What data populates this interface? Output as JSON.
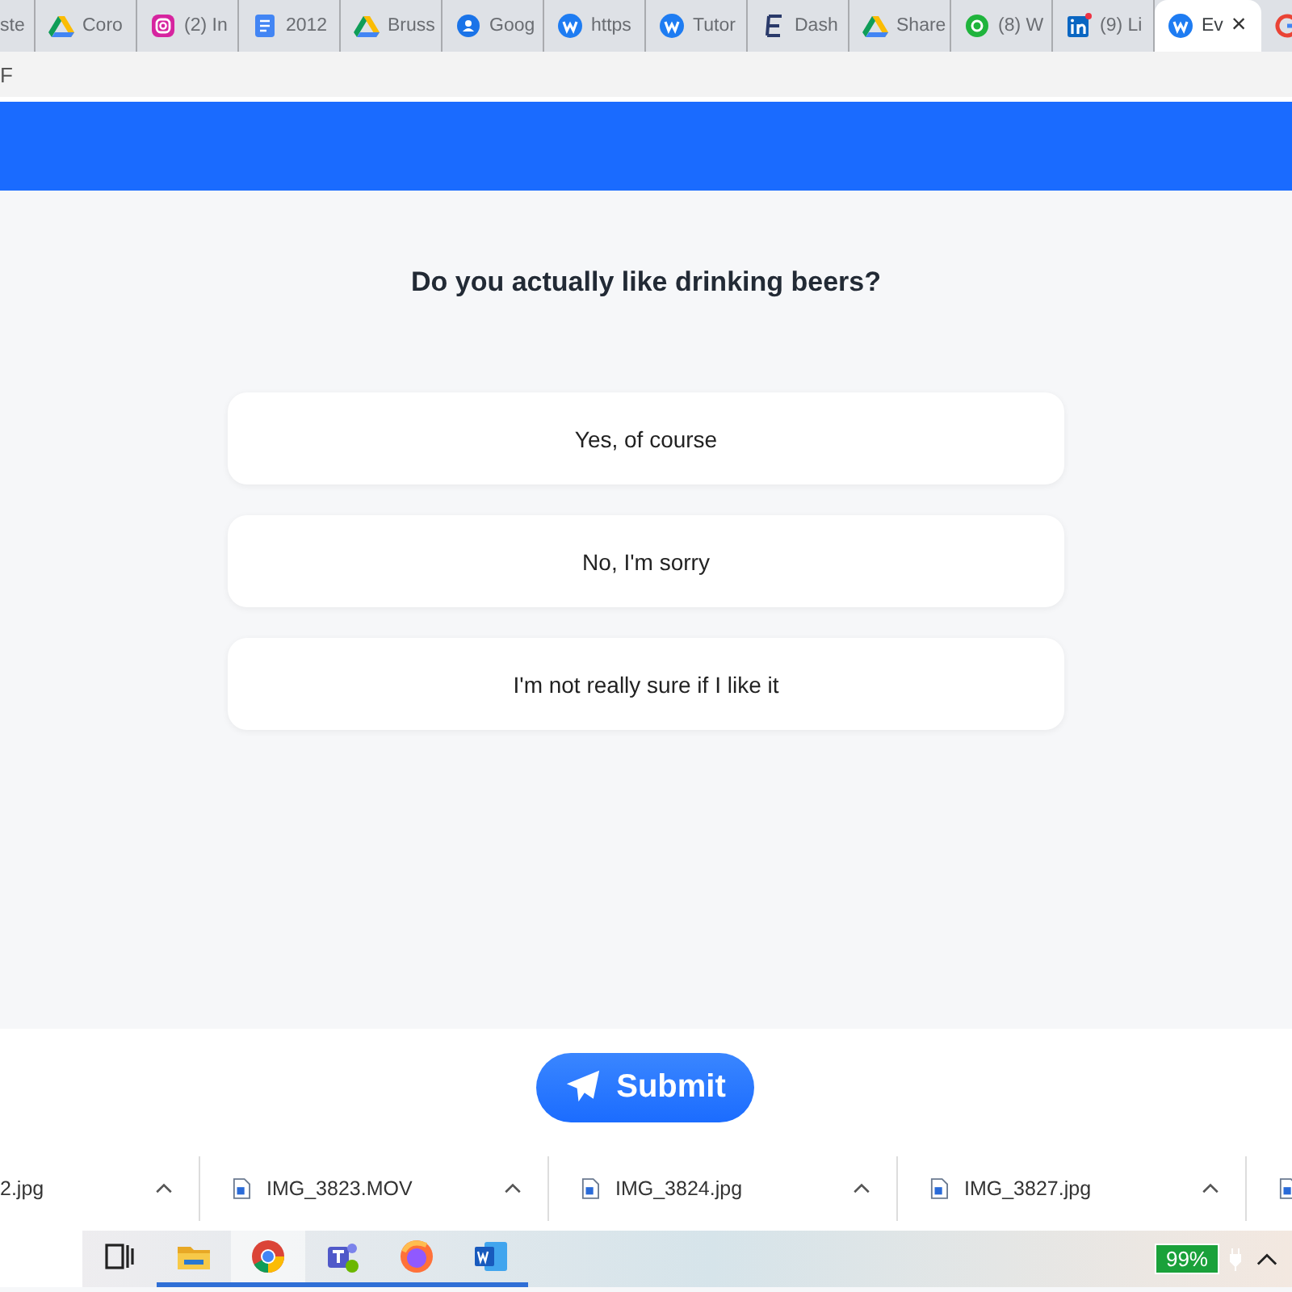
{
  "tabs": [
    {
      "label": "ste",
      "kind": "none",
      "selected": false
    },
    {
      "label": "Coro",
      "kind": "drive",
      "selected": false
    },
    {
      "label": "(2) In",
      "kind": "instagram",
      "selected": false
    },
    {
      "label": "2012",
      "kind": "docs",
      "selected": false
    },
    {
      "label": "Bruss",
      "kind": "drive",
      "selected": false
    },
    {
      "label": "Goog",
      "kind": "account",
      "selected": false
    },
    {
      "label": "https",
      "kind": "w",
      "selected": false
    },
    {
      "label": "Tutor",
      "kind": "w",
      "selected": false
    },
    {
      "label": "Dash",
      "kind": "e",
      "selected": false
    },
    {
      "label": "Share",
      "kind": "drive",
      "selected": false
    },
    {
      "label": "(8) W",
      "kind": "chat",
      "selected": false
    },
    {
      "label": "(9) Li",
      "kind": "linkedin",
      "selected": false
    },
    {
      "label": "Ev",
      "kind": "w",
      "selected": true,
      "close": "×"
    },
    {
      "kind": "google",
      "selected": false
    }
  ],
  "address_bar": {
    "value": "F"
  },
  "question": "Do you actually like drinking beers?",
  "options": [
    {
      "label": "Yes, of course",
      "selected": false
    },
    {
      "label": "No, I'm sorry",
      "selected": false
    },
    {
      "label": "I'm not really sure if I like it",
      "selected": false
    }
  ],
  "submit_button": "Submit",
  "downloads": [
    {
      "name": "2.jpg",
      "kind": "none"
    },
    {
      "name": "IMG_3823.MOV",
      "kind": "file"
    },
    {
      "name": "IMG_3824.jpg",
      "kind": "file"
    },
    {
      "name": "IMG_3827.jpg",
      "kind": "file"
    },
    {
      "kind": "file"
    }
  ],
  "taskbar": {
    "apps": [
      {
        "kind": "taskview"
      },
      {
        "kind": "explorer",
        "running": true,
        "selected": false
      },
      {
        "kind": "chrome",
        "running": true,
        "selected": true
      },
      {
        "kind": "teams",
        "running": true,
        "selected": false
      },
      {
        "kind": "firefox",
        "running": true,
        "selected": false
      },
      {
        "kind": "word",
        "running": true,
        "selected": false
      }
    ],
    "battery": "99%"
  }
}
